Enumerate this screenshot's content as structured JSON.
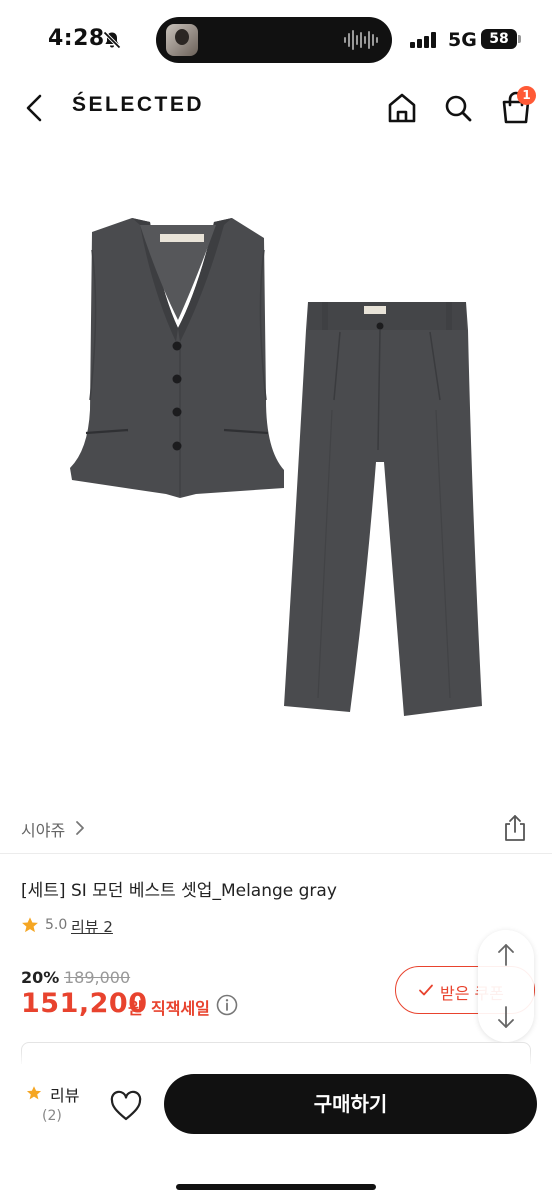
{
  "status_bar": {
    "time": "4:28",
    "network": "5G",
    "battery": "58"
  },
  "nav": {
    "brand": "ŚELECTED",
    "cart_badge": "1"
  },
  "seller": {
    "name": "시야쥬"
  },
  "product": {
    "title": "[세트] SI 모던 베스트 셋업_Melange gray",
    "rating": "5.0",
    "review_link": "리뷰 2",
    "discount_rate": "20%",
    "original_price": "189,000",
    "sale_price": "151,200",
    "price_unit": "원",
    "sale_type": "직잭세일"
  },
  "coupon": {
    "label": "받은 쿠폰"
  },
  "bottom_bar": {
    "review_label": "리뷰",
    "review_count": "(2)",
    "buy_label": "구매하기"
  },
  "colors": {
    "accent": "#e8432e",
    "badge": "#ff5a36",
    "garment": "#4a4b4e"
  }
}
